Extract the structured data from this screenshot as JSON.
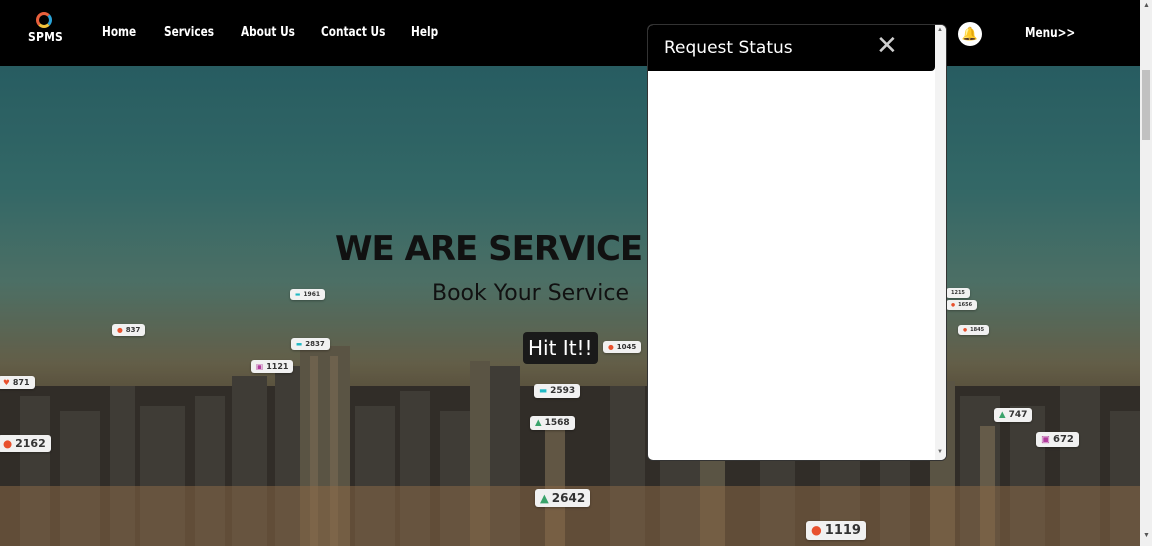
{
  "brand": {
    "logo_text": "SPMS"
  },
  "nav": {
    "items": [
      "Home",
      "Services",
      "About Us",
      "Contact Us",
      "Help"
    ],
    "menu_label": "Menu>>",
    "bell_icon": "bell-icon"
  },
  "hero": {
    "title": "WE ARE SERVICE P",
    "subtitle": "Book Your Service",
    "button_label": "Hit It!!"
  },
  "badges": {
    "b1961": "1961",
    "b837": "837",
    "b2837": "2837",
    "b1121": "1121",
    "b871": "871",
    "b1045": "1045",
    "b2593": "2593",
    "b1568": "1568",
    "b2162": "2162",
    "b2642": "2642",
    "b1119": "1119",
    "b747": "747",
    "b672": "672",
    "b1215": "1215",
    "b1656": "1656",
    "b1845": "1845"
  },
  "modal": {
    "title": "Request Status",
    "close_glyph": "✕"
  },
  "colors": {
    "nav_bg": "#000000",
    "modal_bg": "#ffffff",
    "button_bg": "#1a1a1a"
  }
}
